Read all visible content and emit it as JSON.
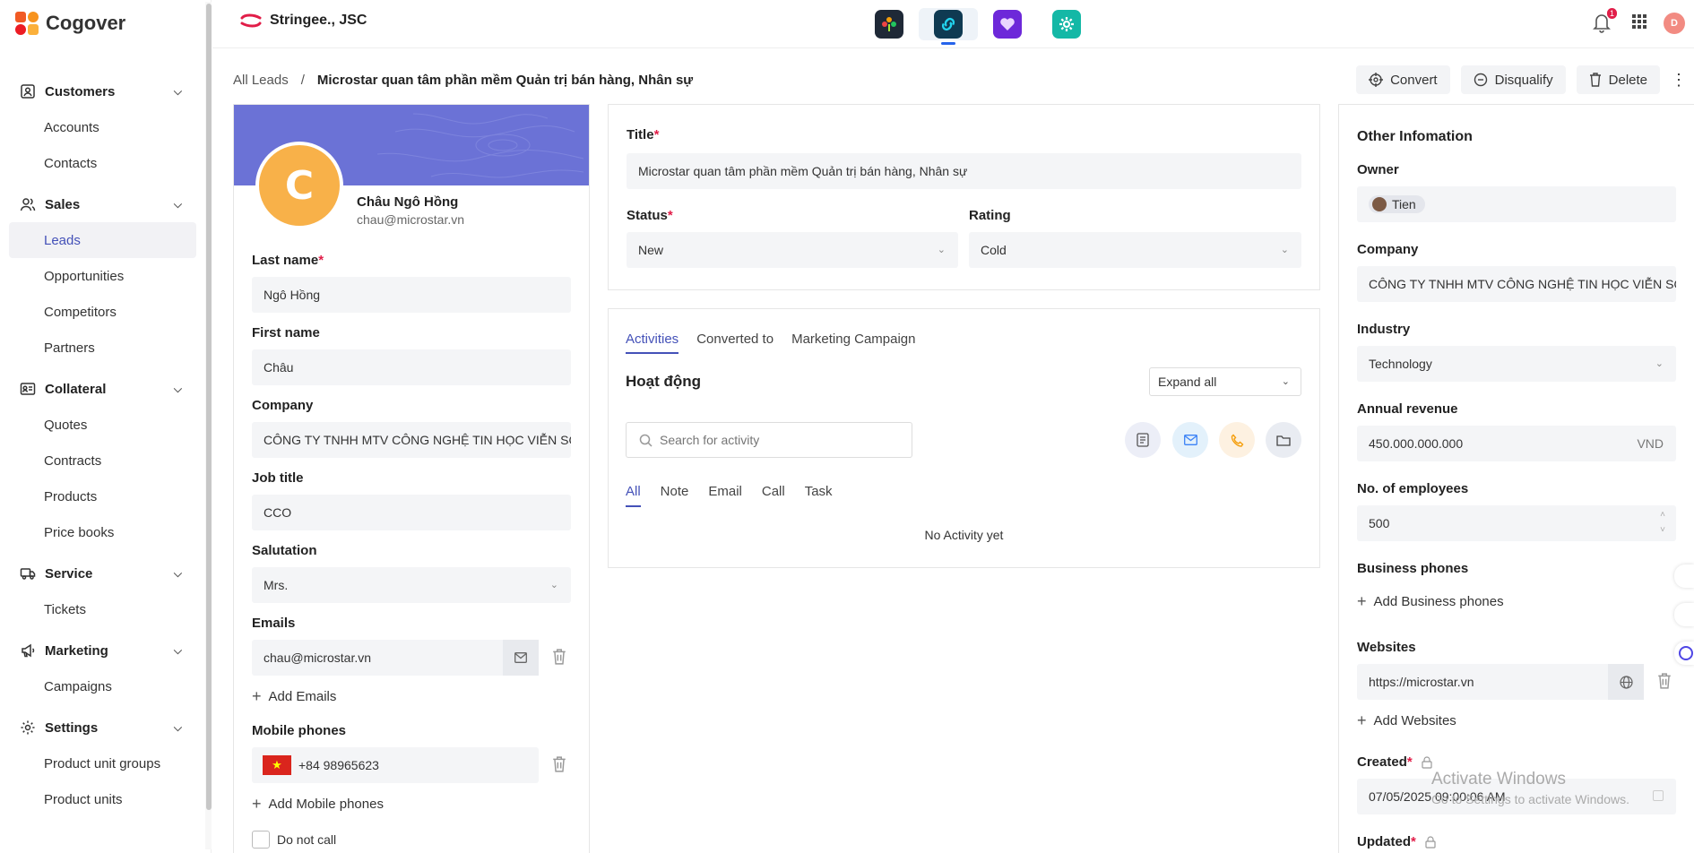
{
  "app": {
    "name": "Cogover"
  },
  "org": {
    "name": "Stringee., JSC"
  },
  "notifications": {
    "count": "1"
  },
  "user": {
    "initial": "D"
  },
  "sidebar": {
    "sections": [
      {
        "label": "Customers",
        "icon": "contact-card-icon",
        "items": [
          "Accounts",
          "Contacts"
        ]
      },
      {
        "label": "Sales",
        "icon": "users-icon",
        "items": [
          "Leads",
          "Opportunities",
          "Competitors",
          "Partners"
        ]
      },
      {
        "label": "Collateral",
        "icon": "cards-icon",
        "items": [
          "Quotes",
          "Contracts",
          "Products",
          "Price books"
        ]
      },
      {
        "label": "Service",
        "icon": "truck-icon",
        "items": [
          "Tickets"
        ]
      },
      {
        "label": "Marketing",
        "icon": "megaphone-icon",
        "items": [
          "Campaigns"
        ]
      },
      {
        "label": "Settings",
        "icon": "gear-icon",
        "items": [
          "Product unit groups",
          "Product units"
        ]
      }
    ],
    "active": "Leads"
  },
  "breadcrumb": {
    "root": "All Leads",
    "sep": "/",
    "current": "Microstar quan tâm phần mềm Quản trị bán hàng, Nhân sự"
  },
  "actions": {
    "convert": "Convert",
    "disqualify": "Disqualify",
    "delete": "Delete"
  },
  "profile": {
    "initial": "C",
    "name": "Châu Ngô Hồng",
    "email": "chau@microstar.vn",
    "last_name_label": "Last name",
    "last_name": "Ngô Hồng",
    "first_name_label": "First name",
    "first_name": "Châu",
    "company_label": "Company",
    "company": "CÔNG TY TNHH MTV CÔNG NGHỆ TIN HỌC VIỄN SƠN",
    "job_title_label": "Job title",
    "job_title": "CCO",
    "salutation_label": "Salutation",
    "salutation": "Mrs.",
    "emails_label": "Emails",
    "email_value": "chau@microstar.vn",
    "add_emails": "Add Emails",
    "mobile_label": "Mobile phones",
    "mobile_value": "+84 98965623",
    "add_mobile": "Add Mobile phones",
    "do_not_call": "Do not call"
  },
  "main": {
    "title_label": "Title",
    "title_value": "Microstar quan tâm phần mềm Quản trị bán hàng, Nhân sự",
    "status_label": "Status",
    "status_value": "New",
    "rating_label": "Rating",
    "rating_value": "Cold"
  },
  "activities": {
    "tabs": [
      "Activities",
      "Converted to",
      "Marketing Campaign"
    ],
    "heading": "Hoạt động",
    "expand": "Expand all",
    "search_placeholder": "Search for activity",
    "filters": [
      "All",
      "Note",
      "Email",
      "Call",
      "Task"
    ],
    "empty": "No Activity yet"
  },
  "other": {
    "heading": "Other Infomation",
    "owner_label": "Owner",
    "owner": "Tien",
    "company_label": "Company",
    "company": "CÔNG TY TNHH MTV CÔNG NGHỆ TIN HỌC VIỄN SƠN",
    "industry_label": "Industry",
    "industry": "Technology",
    "revenue_label": "Annual revenue",
    "revenue": "450.000.000.000",
    "currency": "VND",
    "employees_label": "No. of employees",
    "employees": "500",
    "biz_phones_label": "Business phones",
    "add_biz_phones": "Add Business phones",
    "websites_label": "Websites",
    "website": "https://microstar.vn",
    "add_websites": "Add Websites",
    "created_label": "Created",
    "created": "07/05/2025 09:00:06 AM",
    "updated_label": "Updated"
  },
  "watermark": {
    "line1": "Activate Windows",
    "line2": "Go to Settings to activate Windows."
  },
  "colors": {
    "accent": "#4451b8",
    "cover": "#6b72d6",
    "avatar": "#f8b149",
    "required": "#e11d48"
  }
}
